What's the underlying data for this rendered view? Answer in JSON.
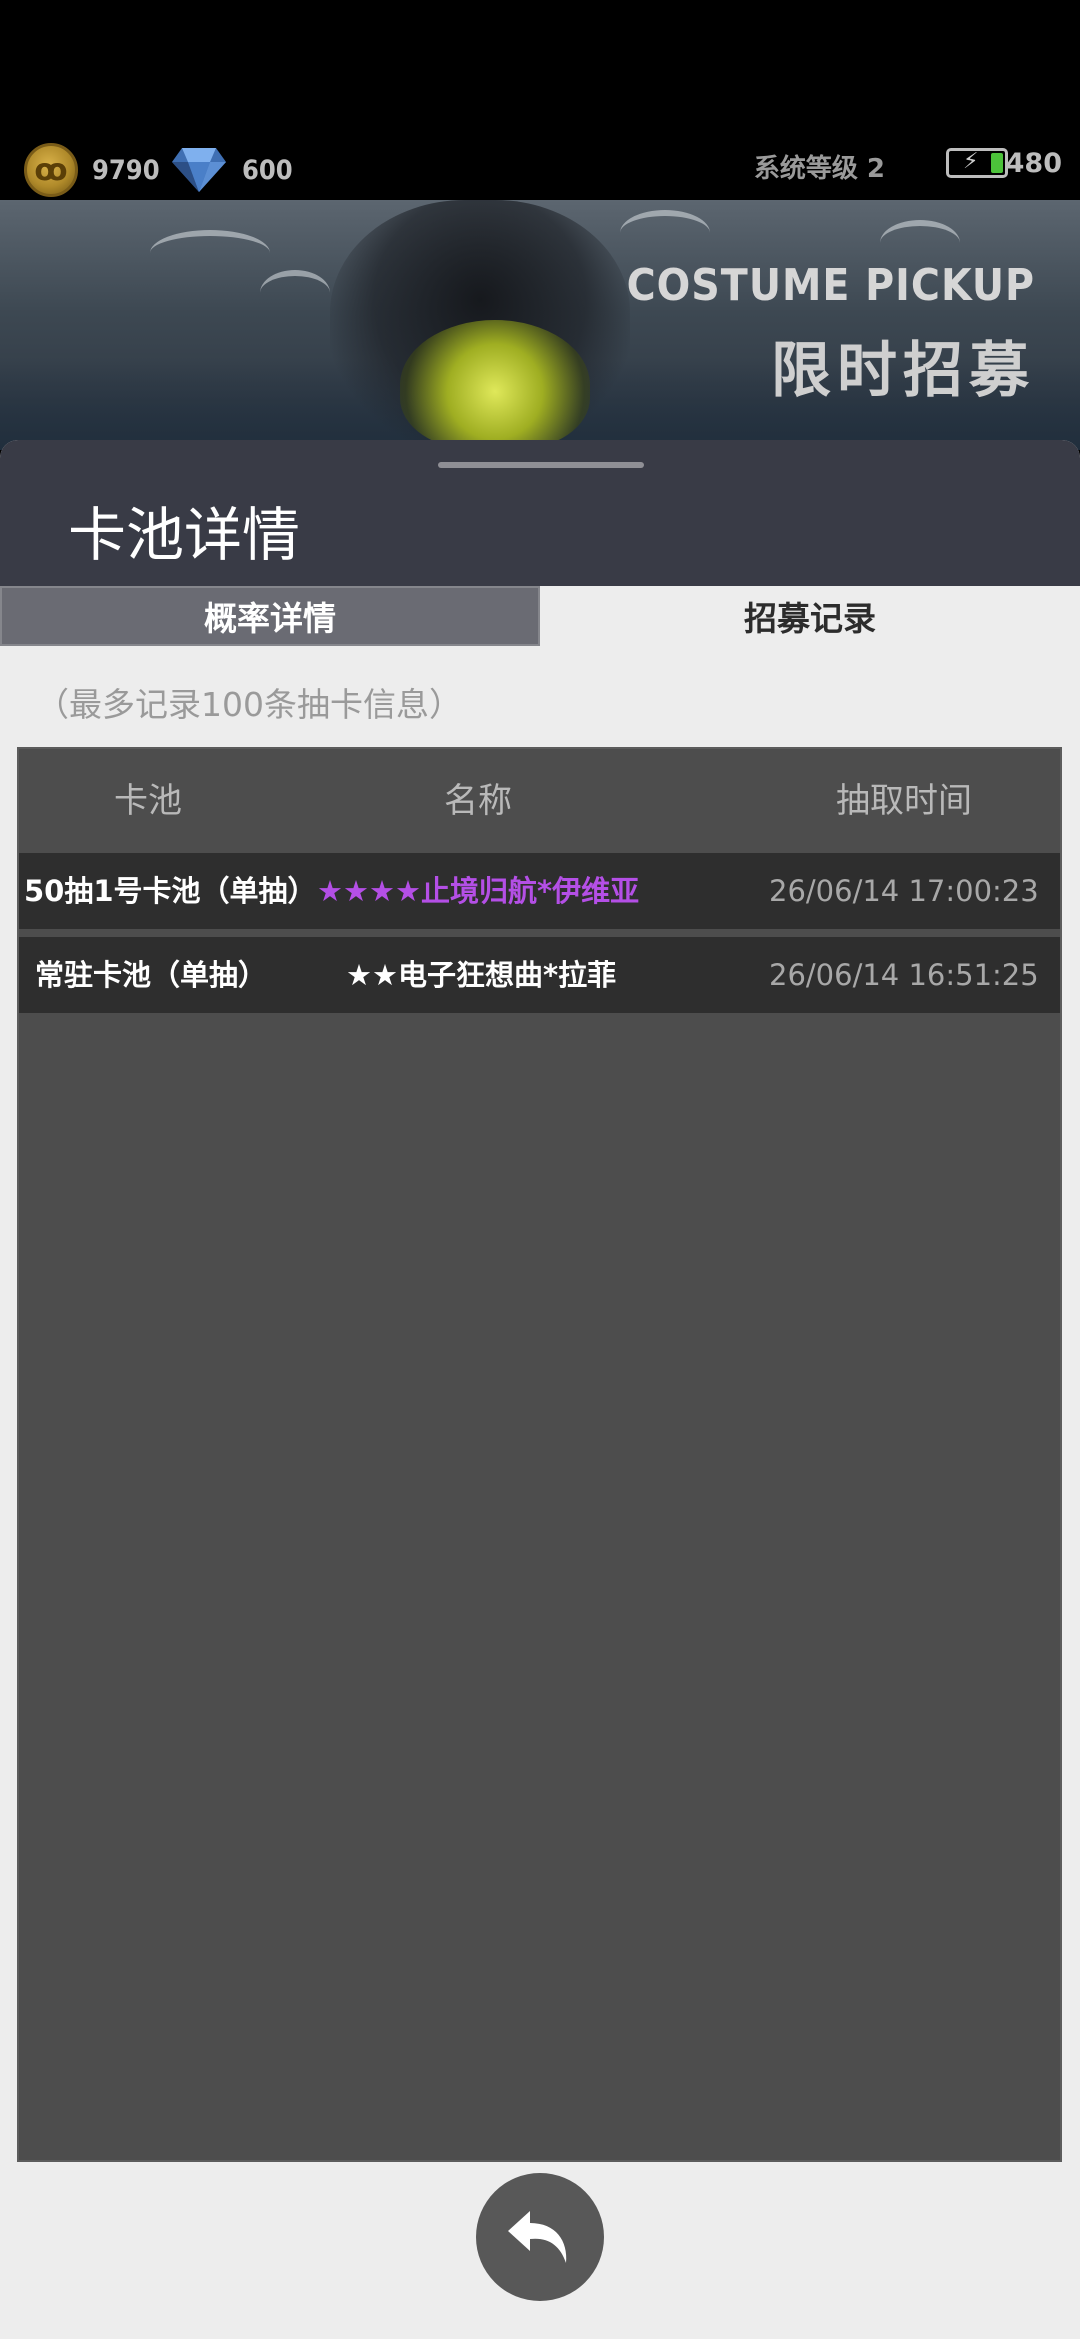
{
  "status": {
    "coins": "9790",
    "gems": "600",
    "system_level": "系统等级 2",
    "energy": "480"
  },
  "banner": {
    "title_en": "COSTUME PICKUP",
    "title_cn": "限时招募"
  },
  "panel": {
    "title": "卡池详情",
    "tabs": [
      {
        "label": "概率详情",
        "active": false
      },
      {
        "label": "招募记录",
        "active": true
      }
    ],
    "note": "（最多记录100条抽卡信息）",
    "table": {
      "headers": [
        "卡池",
        "名称",
        "抽取时间"
      ],
      "rows": [
        {
          "pool": "50抽1号卡池（单抽）",
          "name": "★★★★止境归航*伊维亚",
          "name_color": "#b44fe6",
          "time": "26/06/14 17:00:23"
        },
        {
          "pool": "常驻卡池（单抽）",
          "name": "★★电子狂想曲*拉菲",
          "name_color": "#ffffff",
          "time": "26/06/14 16:51:25"
        }
      ]
    }
  },
  "icons": {
    "coin": "coin-icon",
    "gem": "diamond-icon",
    "battery": "battery-icon",
    "back": "back-arrow-icon"
  }
}
